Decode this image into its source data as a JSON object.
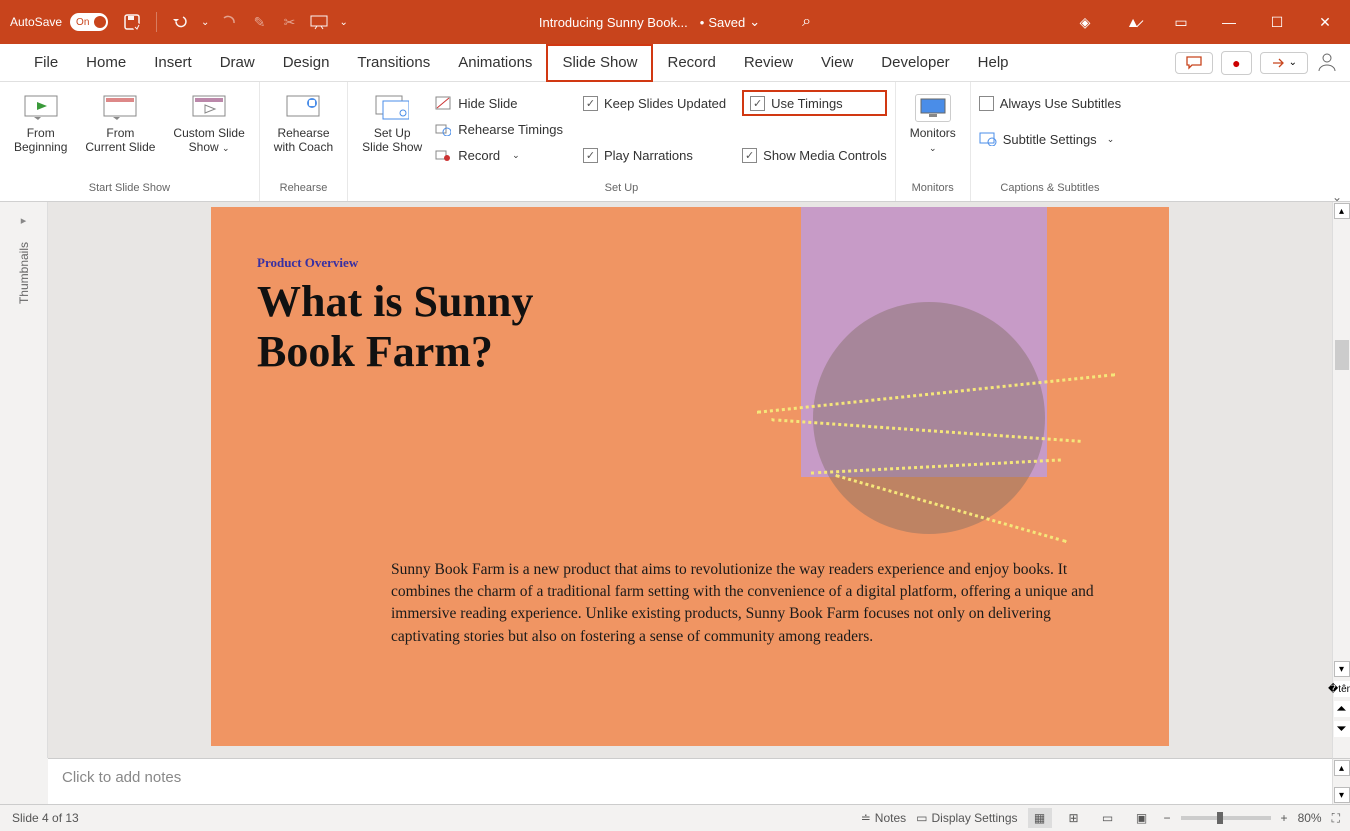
{
  "titlebar": {
    "autosave": "AutoSave",
    "toggle": "On",
    "filename": "Introducing Sunny Book...",
    "save_state": "Saved"
  },
  "tabs": {
    "file": "File",
    "home": "Home",
    "insert": "Insert",
    "draw": "Draw",
    "design": "Design",
    "transitions": "Transitions",
    "animations": "Animations",
    "slideshow": "Slide Show",
    "record": "Record",
    "review": "Review",
    "view": "View",
    "developer": "Developer",
    "help": "Help"
  },
  "ribbon": {
    "start": {
      "from_beginning": "From\nBeginning",
      "from_current": "From\nCurrent Slide",
      "custom": "Custom Slide\nShow",
      "label": "Start Slide Show"
    },
    "rehearse": {
      "coach": "Rehearse\nwith Coach",
      "label": "Rehearse"
    },
    "setup": {
      "big": "Set Up\nSlide Show",
      "hide": "Hide Slide",
      "timings": "Rehearse Timings",
      "record": "Record",
      "keep_updated": "Keep Slides Updated",
      "use_timings": "Use Timings",
      "play_narr": "Play Narrations",
      "media_ctrl": "Show Media Controls",
      "label": "Set Up"
    },
    "monitors": {
      "btn": "Monitors",
      "label": "Monitors"
    },
    "captions": {
      "always": "Always Use Subtitles",
      "settings": "Subtitle Settings",
      "label": "Captions & Subtitles"
    }
  },
  "thumbnails": "Thumbnails",
  "slide": {
    "sub": "Product Overview",
    "title": "What is Sunny\nBook Farm?",
    "body": "Sunny Book Farm is a new product that aims to revolutionize the way readers experience and enjoy books. It combines the charm of a traditional farm setting with the convenience of a digital platform, offering a unique and immersive reading experience. Unlike existing products, Sunny Book Farm focuses not only on delivering captivating stories but also on fostering a sense of community among readers."
  },
  "notes": "Click to add notes",
  "status": {
    "slide": "Slide 4 of 13",
    "notes": "Notes",
    "display": "Display Settings",
    "zoom": "80%"
  }
}
